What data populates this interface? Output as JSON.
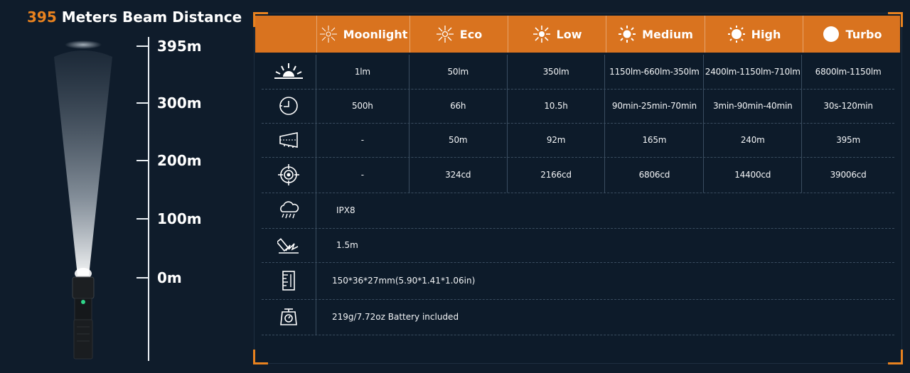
{
  "beam": {
    "title_value": "395",
    "title_text": "Meters Beam Distance",
    "scale_labels": [
      "395m",
      "300m",
      "200m",
      "100m",
      "0m"
    ]
  },
  "table": {
    "modes": [
      "Moonlight",
      "Eco",
      "Low",
      "Medium",
      "High",
      "Turbo"
    ],
    "rows": [
      {
        "icon": "brightness-lumens-icon",
        "values": [
          "1lm",
          "50lm",
          "350lm",
          "1150lm-660lm-350lm",
          "2400lm-1150lm-710lm",
          "6800lm-1150lm"
        ]
      },
      {
        "icon": "runtime-clock-icon",
        "values": [
          "500h",
          "66h",
          "10.5h",
          "90min-25min-70min",
          "3min-90min-40min",
          "30s-120min"
        ]
      },
      {
        "icon": "beam-distance-icon",
        "values": [
          "-",
          "50m",
          "92m",
          "165m",
          "240m",
          "395m"
        ]
      },
      {
        "icon": "intensity-target-icon",
        "values": [
          "-",
          "324cd",
          "2166cd",
          "6806cd",
          "14400cd",
          "39006cd"
        ]
      }
    ],
    "specs": [
      {
        "icon": "waterproof-rain-icon",
        "value": "IPX8"
      },
      {
        "icon": "impact-resistance-icon",
        "value": "1.5m"
      },
      {
        "icon": "dimensions-ruler-icon",
        "value": "150*36*27mm(5.90*1.41*1.06in)"
      },
      {
        "icon": "weight-scale-icon",
        "value": "219g/7.72oz Battery included"
      }
    ]
  },
  "colors": {
    "background": "#0f1c2b",
    "accent": "#e8821f",
    "header": "#d9731f"
  }
}
